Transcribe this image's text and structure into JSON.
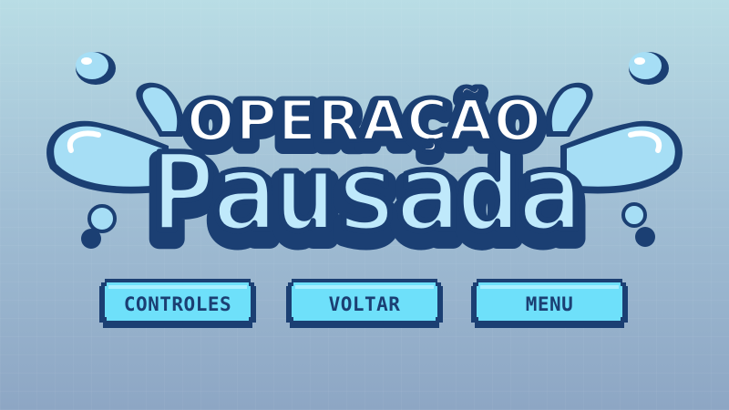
{
  "title": {
    "line1": "OPERAÇÃO",
    "line2": "Pausada"
  },
  "buttons": {
    "controles": "CONTROLES",
    "voltar": "VOLTAR",
    "menu": "MENU"
  },
  "colors": {
    "background_top": "#b9dde5",
    "background_bottom": "#8da6c4",
    "outline_navy": "#1b3f73",
    "water_light": "#a6def5",
    "title_fill": "#ffffff",
    "pausada_fill": "#bfe9fb",
    "button_fill": "#6ee0fa"
  }
}
